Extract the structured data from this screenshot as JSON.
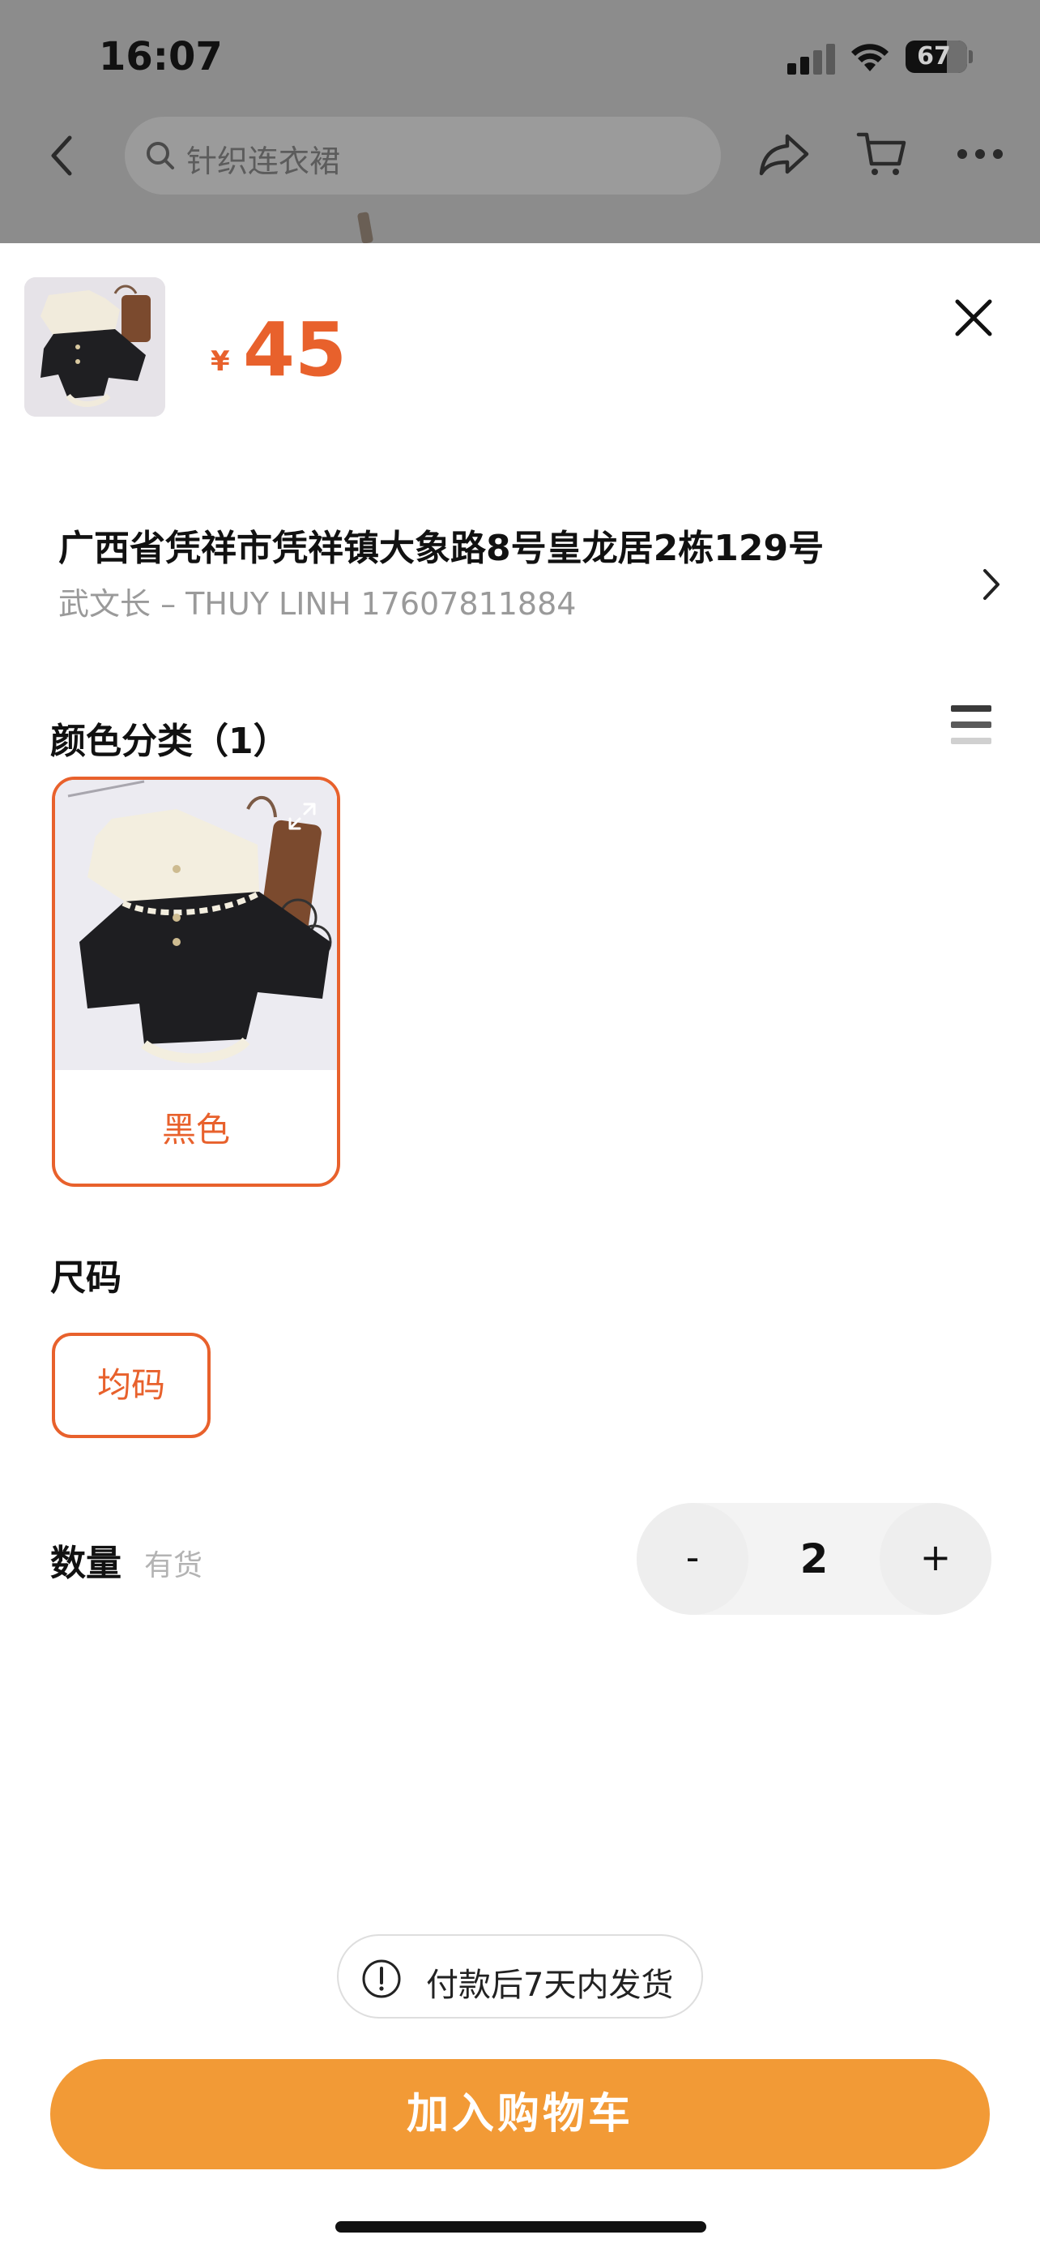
{
  "status_bar": {
    "time": "16:07",
    "battery": "67"
  },
  "nav": {
    "search_placeholder": "针织连衣裙"
  },
  "sheet": {
    "price_symbol": "¥",
    "price": "45",
    "address": {
      "line": "广西省凭祥市凭祥镇大象路8号皇龙居2栋129号",
      "recipient": "武文长 – THUY LINH 17607811884"
    },
    "color_section": {
      "title": "颜色分类（1）",
      "options": [
        {
          "label": "黑色",
          "selected": true
        }
      ]
    },
    "size_section": {
      "title": "尺码",
      "options": [
        {
          "label": "均码",
          "selected": true
        }
      ]
    },
    "quantity": {
      "title": "数量",
      "stock_status": "有货",
      "minus_label": "-",
      "value": "2",
      "plus_label": "+"
    },
    "shipping_note": "付款后7天内发货",
    "add_to_cart_label": "加入购物车"
  },
  "colors": {
    "accent": "#e8612c",
    "button": "#f29a36",
    "overlay": "#8c8c8c"
  }
}
